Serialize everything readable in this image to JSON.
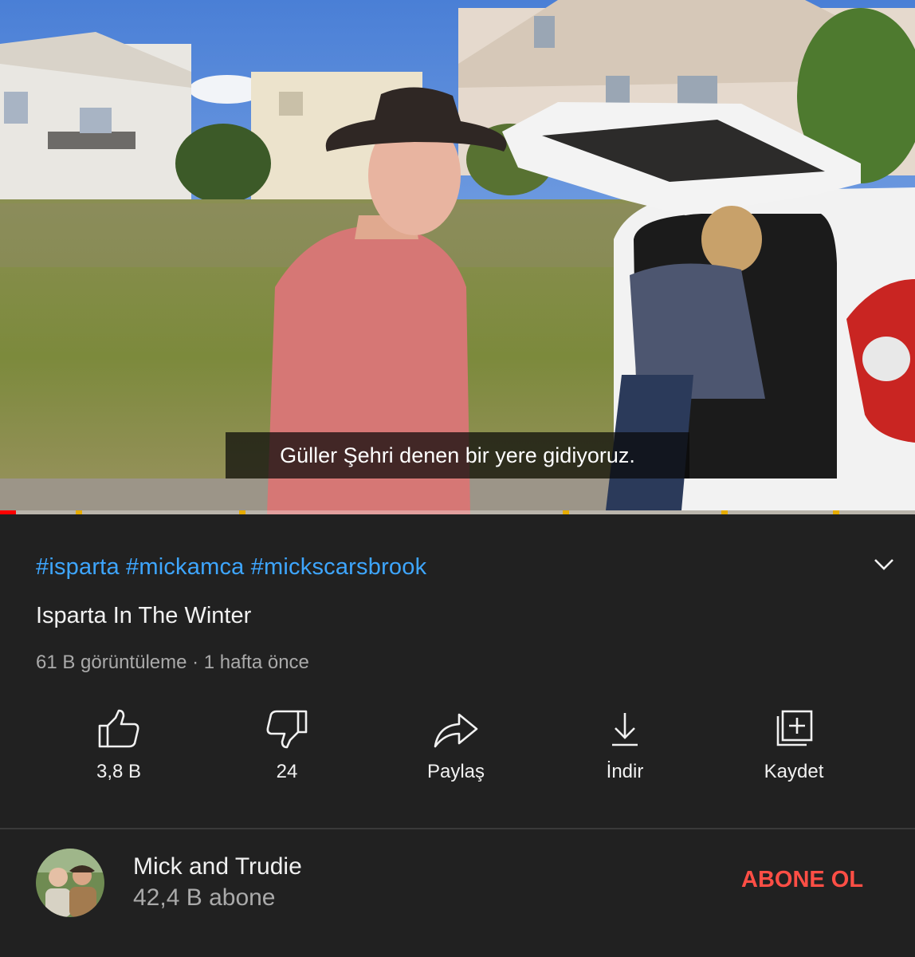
{
  "video": {
    "caption": "Güller Şehri denen bir yere gidiyoruz.",
    "progress_fraction": 0.017
  },
  "info": {
    "hashtags": "#isparta #mickamca #mickscarsbrook",
    "title": "Isparta In The Winter",
    "meta": "61 B görüntüleme · 1 hafta önce"
  },
  "actions": {
    "like_count": "3,8 B",
    "dislike_count": "24",
    "share_label": "Paylaş",
    "download_label": "İndir",
    "save_label": "Kaydet"
  },
  "channel": {
    "name": "Mick and Trudie",
    "subscribers": "42,4 B abone",
    "subscribe_label": "ABONE OL"
  },
  "colors": {
    "background": "#212121",
    "hashtag": "#3ea6ff",
    "subscribe": "#ff4e45",
    "progress": "#ff0000",
    "chapter_marker": "#e6ac00"
  },
  "icons": [
    "thumbs-up-icon",
    "thumbs-down-icon",
    "share-icon",
    "download-icon",
    "playlist-add-icon",
    "chevron-down-icon"
  ]
}
